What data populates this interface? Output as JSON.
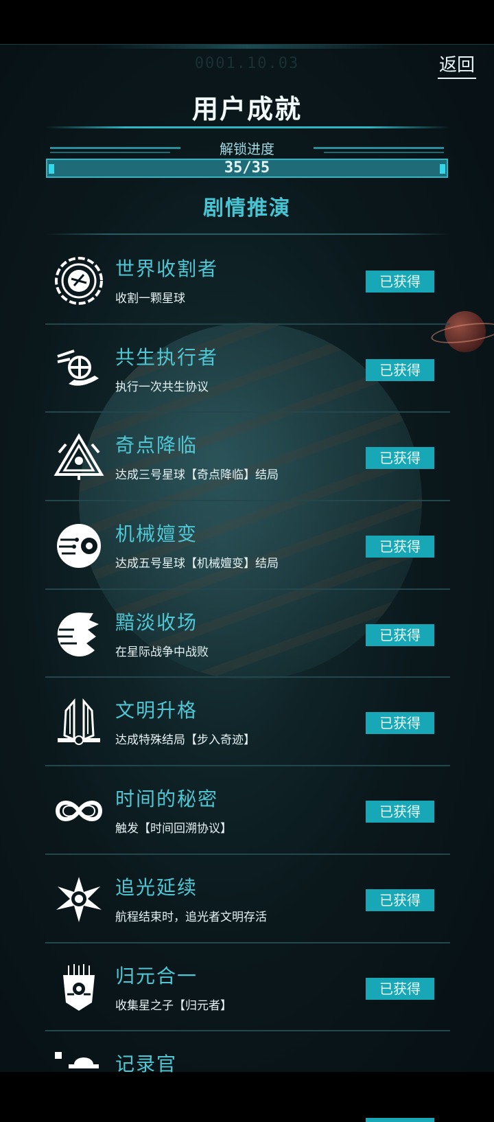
{
  "header": {
    "date": "0001.10.03",
    "back_label": "返回",
    "title": "用户成就"
  },
  "progress": {
    "label": "解锁进度",
    "text": "35/35",
    "unlocked": 35,
    "total": 35,
    "fraction": 1.0
  },
  "section": {
    "title": "剧情推演"
  },
  "colors": {
    "accent": "#18a7b6",
    "name_text": "#4fc7d4",
    "background": "#0a171b"
  },
  "achievements": [
    {
      "name": "世界收割者",
      "desc": "收割一颗星球",
      "status": "已获得",
      "icon": "planet-harvest-icon"
    },
    {
      "name": "共生执行者",
      "desc": "执行一次共生协议",
      "status": "已获得",
      "icon": "symbiosis-globe-hand-icon"
    },
    {
      "name": "奇点降临",
      "desc": "达成三号星球【奇点降临】结局",
      "status": "已获得",
      "icon": "singularity-triangle-icon"
    },
    {
      "name": "机械嬗变",
      "desc": "达成五号星球【机械嬗变】结局",
      "status": "已获得",
      "icon": "mechanical-eye-icon"
    },
    {
      "name": "黯淡收场",
      "desc": "在星际战争中战败",
      "status": "已获得",
      "icon": "shattered-planet-icon"
    },
    {
      "name": "文明升格",
      "desc": "达成特殊结局【步入奇迹】",
      "status": "已获得",
      "icon": "winged-emblem-icon"
    },
    {
      "name": "时间的秘密",
      "desc": "触发【时间回溯协议】",
      "status": "已获得",
      "icon": "infinity-icon"
    },
    {
      "name": "追光延续",
      "desc": "航程结束时，追光者文明存活",
      "status": "已获得",
      "icon": "radiant-core-icon"
    },
    {
      "name": "归元合一",
      "desc": "收集星之子【归元者】",
      "status": "已获得",
      "icon": "circuit-mask-icon"
    },
    {
      "name": "记录官",
      "desc": "",
      "status": "",
      "icon": "recorder-icon"
    }
  ]
}
